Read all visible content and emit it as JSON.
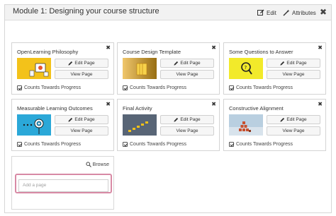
{
  "module": {
    "title": "Module 1: Designing your course structure",
    "edit_label": "Edit",
    "attributes_label": "Attributes",
    "close_symbol": "✖"
  },
  "cards": [
    {
      "title": "OpenLearning Philosophy",
      "edit_label": "Edit Page",
      "view_label": "View Page",
      "progress_label": "Counts Towards Progress",
      "close_symbol": "✖",
      "thumb_color": "#f3c21a"
    },
    {
      "title": "Course Design Template",
      "edit_label": "Edit Page",
      "view_label": "View Page",
      "progress_label": "Counts Towards Progress",
      "close_symbol": "✖",
      "thumb_color": "#e8a81c"
    },
    {
      "title": "Some Questions to Answer",
      "edit_label": "Edit Page",
      "view_label": "View Page",
      "progress_label": "Counts Towards Progress",
      "close_symbol": "✖",
      "thumb_color": "#f2ea2a"
    },
    {
      "title": "Measurable Learning Outcomes",
      "edit_label": "Edit Page",
      "view_label": "View Page",
      "progress_label": "Counts Towards Progress",
      "close_symbol": "✖",
      "thumb_color": "#2ba8d8"
    },
    {
      "title": "Final Activity",
      "edit_label": "Edit Page",
      "view_label": "View Page",
      "progress_label": "Counts Towards Progress",
      "close_symbol": "✖",
      "thumb_color": "#6b7a8c"
    },
    {
      "title": "Constructive Alignment",
      "edit_label": "Edit Page",
      "view_label": "View Page",
      "progress_label": "Counts Towards Progress",
      "close_symbol": "✖",
      "thumb_color": "#8fb0c8"
    }
  ],
  "add_page": {
    "browse_label": "Browse",
    "placeholder": "Add a page"
  },
  "colors": {
    "header_bg": "#f2f2f2",
    "highlight_border": "#d88aa5"
  }
}
